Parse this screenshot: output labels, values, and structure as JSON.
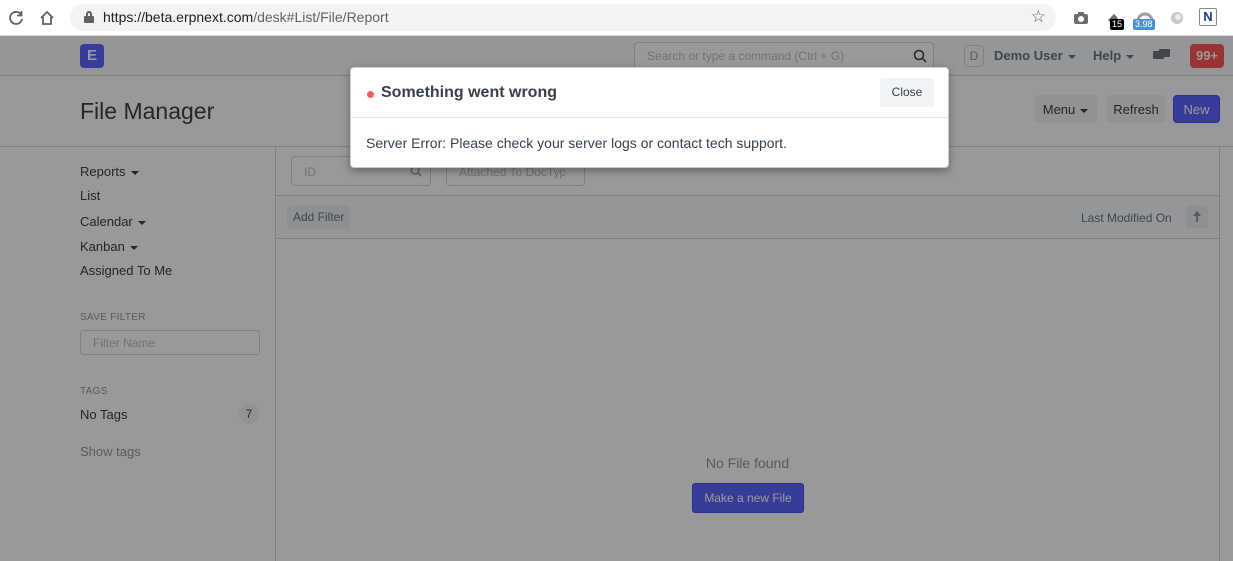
{
  "browser": {
    "url_host": "https://beta.erpnext.com",
    "url_path": "/desk#List/File/Report",
    "ext_badges": [
      "15",
      "3.98"
    ],
    "ext_n_label": "N"
  },
  "navbar": {
    "logo_letter": "E",
    "search_placeholder": "Search or type a command (Ctrl + G)",
    "avatar_letter": "D",
    "user_label": "Demo User",
    "help_label": "Help",
    "notification_count": "99+"
  },
  "page": {
    "title": "File Manager",
    "menu_label": "Menu",
    "refresh_label": "Refresh",
    "new_label": "New"
  },
  "sidebar": {
    "items": [
      {
        "label": "Reports",
        "dropdown": true
      },
      {
        "label": "List",
        "dropdown": false
      },
      {
        "label": "Calendar",
        "dropdown": true
      },
      {
        "label": "Kanban",
        "dropdown": true
      },
      {
        "label": "Assigned To Me",
        "dropdown": false
      }
    ],
    "save_filter_heading": "SAVE FILTER",
    "filter_name_placeholder": "Filter Name",
    "tags_heading": "TAGS",
    "no_tags_label": "No Tags",
    "no_tags_count": "7",
    "show_tags_label": "Show tags"
  },
  "list": {
    "id_placeholder": "ID",
    "attached_placeholder": "Attached To DocType",
    "add_filter_label": "Add Filter",
    "sort_label": "Last Modified On",
    "empty_text": "No File found",
    "make_new_label": "Make a new File"
  },
  "modal": {
    "title": "Something went wrong",
    "close_label": "Close",
    "message": "Server Error: Please check your server logs or contact tech support."
  },
  "colors": {
    "primary": "#5e64ff",
    "danger": "#ff5858"
  }
}
